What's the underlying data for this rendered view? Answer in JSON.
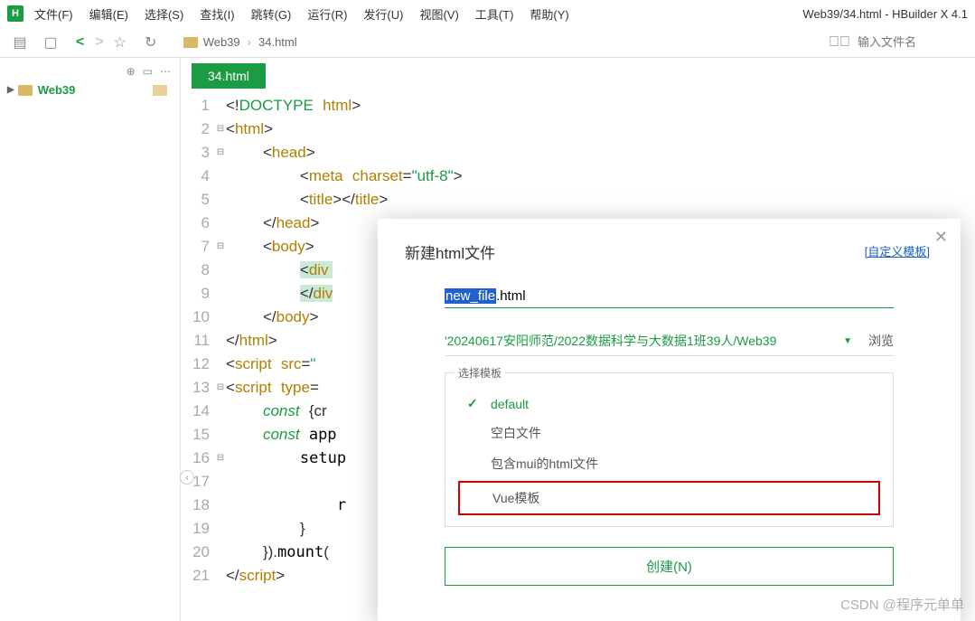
{
  "menu": {
    "items": [
      "文件(F)",
      "编辑(E)",
      "选择(S)",
      "查找(I)",
      "跳转(G)",
      "运行(R)",
      "发行(U)",
      "视图(V)",
      "工具(T)",
      "帮助(Y)"
    ]
  },
  "window_title": "Web39/34.html - HBuilder X 4.1",
  "logo": "H",
  "breadcrumb": {
    "folder": "Web39",
    "file": "34.html"
  },
  "search_placeholder": "输入文件名",
  "sidebar": {
    "project": "Web39"
  },
  "tab": {
    "label": "34.html"
  },
  "code": {
    "lines": [
      {
        "n": "1",
        "fold": "",
        "html": "<span class='punct'>&lt;!</span><span class='kw'>DOCTYPE</span> <span class='tag'>html</span><span class='punct'>&gt;</span>"
      },
      {
        "n": "2",
        "fold": "⊟",
        "html": "<span class='punct'>&lt;</span><span class='tag'>html</span><span class='punct'>&gt;</span>"
      },
      {
        "n": "3",
        "fold": "⊟",
        "html": "    <span class='punct'>&lt;</span><span class='tag'>head</span><span class='punct'>&gt;</span>"
      },
      {
        "n": "4",
        "fold": "",
        "html": "        <span class='punct'>&lt;</span><span class='tag'>meta</span> <span class='attr'>charset</span><span class='punct'>=</span><span class='str'>\"utf-8\"</span><span class='punct'>&gt;</span>"
      },
      {
        "n": "5",
        "fold": "",
        "html": "        <span class='punct'>&lt;</span><span class='tag'>title</span><span class='punct'>&gt;&lt;/</span><span class='tag'>title</span><span class='punct'>&gt;</span>"
      },
      {
        "n": "6",
        "fold": "",
        "html": "    <span class='punct'>&lt;/</span><span class='tag'>head</span><span class='punct'>&gt;</span>"
      },
      {
        "n": "7",
        "fold": "⊟",
        "html": "    <span class='punct'>&lt;</span><span class='tag'>body</span><span class='punct'>&gt;</span>"
      },
      {
        "n": "8",
        "fold": "",
        "html": "        <span class='sel'><span class='punct'>&lt;</span><span class='tag'>div</span> </span>"
      },
      {
        "n": "9",
        "fold": "",
        "html": "        <span class='sel'><span class='punct'>&lt;/</span><span class='tag'>div</span></span>"
      },
      {
        "n": "10",
        "fold": "",
        "html": "    <span class='punct'>&lt;/</span><span class='tag'>body</span><span class='punct'>&gt;</span>"
      },
      {
        "n": "11",
        "fold": "",
        "html": "<span class='punct'>&lt;/</span><span class='tag'>html</span><span class='punct'>&gt;</span>"
      },
      {
        "n": "12",
        "fold": "",
        "html": "<span class='punct'>&lt;</span><span class='tag'>script</span> <span class='attr'>src</span><span class='punct'>=</span><span class='str'>\"</span>"
      },
      {
        "n": "13",
        "fold": "⊟",
        "html": "<span class='punct'>&lt;</span><span class='tag'>script</span> <span class='attr'>type</span><span class='punct'>=</span>"
      },
      {
        "n": "14",
        "fold": "",
        "html": "    <span class='kw italic'>const</span> <span class='punct'>{cr</span>"
      },
      {
        "n": "15",
        "fold": "",
        "html": "    <span class='kw italic'>const</span> app"
      },
      {
        "n": "16",
        "fold": "⊟",
        "html": "        setup"
      },
      {
        "n": "17",
        "fold": "",
        "html": ""
      },
      {
        "n": "18",
        "fold": "",
        "html": "            r"
      },
      {
        "n": "19",
        "fold": "",
        "html": "        <span class='punct'>}</span>"
      },
      {
        "n": "20",
        "fold": "",
        "html": "    <span class='punct'>}).</span>mount<span class='punct'>(</span>"
      },
      {
        "n": "21",
        "fold": "",
        "html": "<span class='punct'>&lt;/</span><span class='tag'>script</span><span class='punct'>&gt;</span>"
      }
    ]
  },
  "dialog": {
    "title": "新建html文件",
    "custom_link": "[自定义模板]",
    "filename_selected": "new_file",
    "filename_ext": ".html",
    "path": "'20240617安阳师范/2022数据科学与大数据1班39人/Web39",
    "browse": "浏览",
    "template_legend": "选择模板",
    "templates": [
      {
        "label": "default",
        "checked": true,
        "default": true
      },
      {
        "label": "空白文件",
        "checked": false
      },
      {
        "label": "包含mui的html文件",
        "checked": false
      },
      {
        "label": "Vue模板",
        "checked": false,
        "highlight": true
      }
    ],
    "create_btn": "创建(N)"
  },
  "watermark": "CSDN @程序元单单"
}
